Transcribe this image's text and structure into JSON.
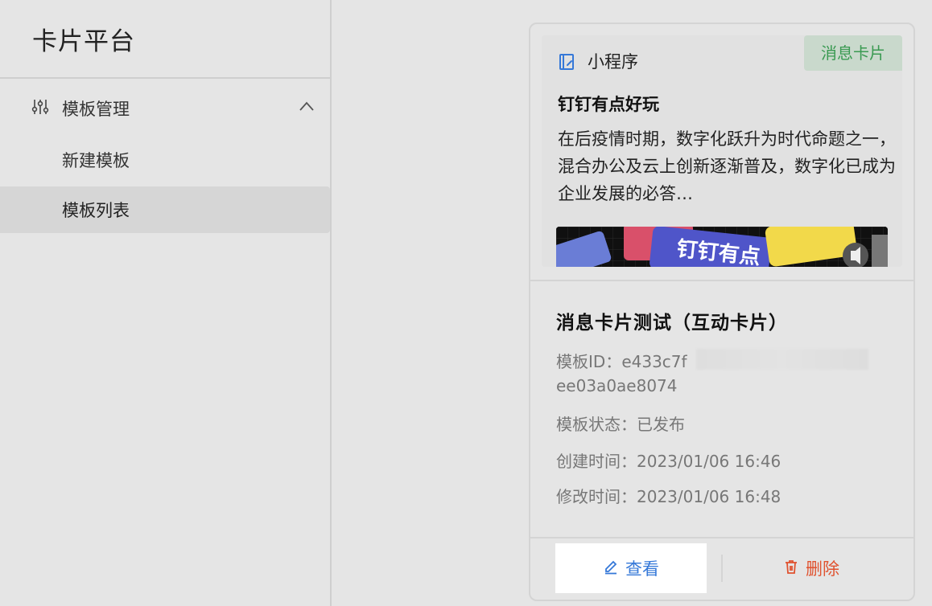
{
  "app": {
    "title": "卡片平台"
  },
  "sidebar": {
    "group": {
      "label": "模板管理",
      "icon": "sliders-icon",
      "expanded": true
    },
    "items": [
      {
        "label": "新建模板",
        "active": false
      },
      {
        "label": "模板列表",
        "active": true
      }
    ]
  },
  "card": {
    "preview": {
      "app_type": "小程序",
      "tag": "消息卡片",
      "title": "钉钉有点好玩",
      "body": "在后疫情时期，数字化跃升为时代命题之一，混合办公及云上创新逐渐普及，数字化已成为企业发展的必答…",
      "image_text": "钉钉有点"
    },
    "name": "消息卡片测试（互动卡片）",
    "template_id_label": "模板ID：",
    "template_id_part1": "e433c7f",
    "template_id_part2": "ee03a0ae8074",
    "status_label": "模板状态：",
    "status_value": "已发布",
    "created_label": "创建时间：",
    "created_value": "2023/01/06 16:46",
    "modified_label": "修改时间：",
    "modified_value": "2023/01/06 16:48",
    "view_label": "查看",
    "delete_label": "删除"
  },
  "colors": {
    "accent": "#3578d8",
    "danger": "#e0522f",
    "tag_bg": "#c9d9cc",
    "tag_text": "#3a9a52"
  }
}
